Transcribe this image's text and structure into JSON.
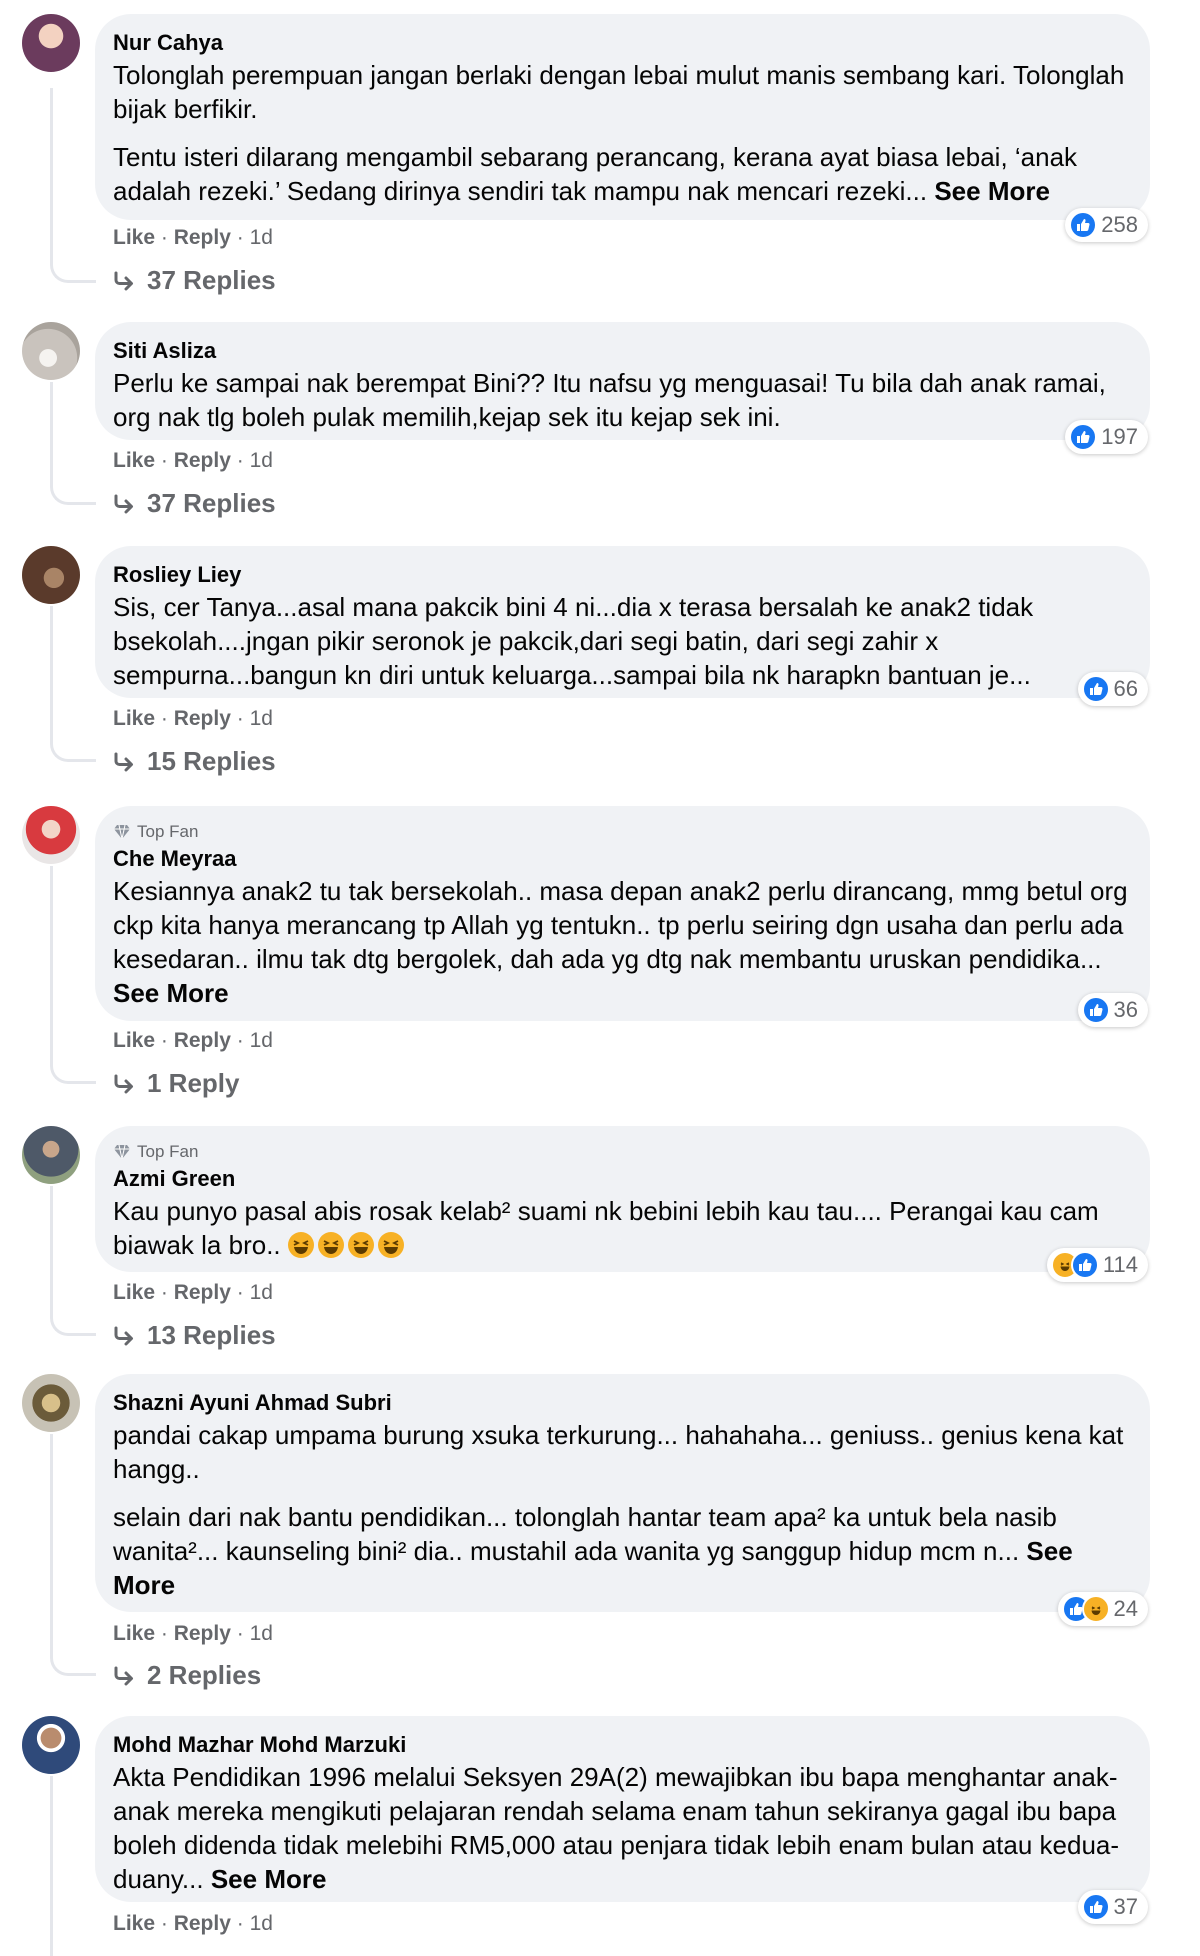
{
  "comments": [
    {
      "author": "Nur Cahya",
      "badge": "",
      "paragraphs": [
        "Tolonglah perempuan jangan berlaki dengan lebai mulut manis sembang kari. Tolonglah bijak berfikir.",
        "Tentu isteri dilarang mengambil sebarang perancang, kerana ayat biasa lebai, ‘anak adalah rezeki.’ Sedang dirinya sendiri tak mampu nak mencari rezeki..."
      ],
      "see_more": "See More",
      "reaction_count": "258",
      "reactions": [
        "like-icon"
      ],
      "like": "Like",
      "reply": "Reply",
      "time": "1d",
      "replies": "37 Replies",
      "avatar_color": "#7a4a6a"
    },
    {
      "author": "Siti Asliza",
      "badge": "",
      "paragraphs": [
        "Perlu ke sampai nak berempat Bini?? Itu nafsu yg menguasai! Tu bila dah anak ramai, org nak tlg boleh pulak memilih,kejap sek itu kejap sek ini."
      ],
      "see_more": "",
      "reaction_count": "197",
      "reactions": [
        "like-icon"
      ],
      "like": "Like",
      "reply": "Reply",
      "time": "1d",
      "replies": "37 Replies",
      "avatar_color": "#c9c3bd"
    },
    {
      "author": "Rosliey Liey",
      "badge": "",
      "paragraphs": [
        "Sis, cer Tanya...asal mana pakcik bini 4 ni...dia x terasa bersalah ke anak2 tidak bsekolah....jngan pikir seronok je pakcik,dari segi batin, dari segi zahir x sempurna...bangun kn diri untuk keluarga...sampai bila nk harapkn bantuan je..."
      ],
      "see_more": "",
      "reaction_count": "66",
      "reactions": [
        "like-icon"
      ],
      "like": "Like",
      "reply": "Reply",
      "time": "1d",
      "replies": "15 Replies",
      "avatar_color": "#6b4b3b"
    },
    {
      "author": "Che Meyraa",
      "badge": "Top Fan",
      "paragraphs": [
        "Kesiannya anak2 tu tak bersekolah.. masa depan anak2 perlu dirancang, mmg betul org ckp kita hanya merancang tp Allah yg tentukn.. tp perlu seiring dgn usaha dan perlu ada kesedaran.. ilmu tak dtg bergolek, dah ada yg dtg nak membantu uruskan pendidika..."
      ],
      "see_more": "See More",
      "reaction_count": "36",
      "reactions": [
        "like-icon"
      ],
      "like": "Like",
      "reply": "Reply",
      "time": "1d",
      "replies": "1 Reply",
      "avatar_color": "#b5303a"
    },
    {
      "author": "Azmi Green",
      "badge": "Top Fan",
      "paragraphs": [
        "Kau punyo pasal abis rosak kelab² suami nk bebini lebih kau tau.... Perangai kau cam biawak la bro.."
      ],
      "emoji_count": 4,
      "see_more": "",
      "reaction_count": "114",
      "reactions": [
        "haha-icon",
        "like-icon"
      ],
      "like": "Like",
      "reply": "Reply",
      "time": "1d",
      "replies": "13 Replies",
      "avatar_color": "#556070"
    },
    {
      "author": "Shazni Ayuni Ahmad Subri",
      "badge": "",
      "paragraphs": [
        "pandai cakap umpama burung xsuka terkurung... hahahaha... geniuss.. genius kena kat hangg..",
        "selain dari nak bantu pendidikan... tolonglah hantar team apa² ka untuk bela nasib wanita²... kaunseling bini² dia.. mustahil ada wanita yg sanggup hidup mcm n..."
      ],
      "see_more": "See More",
      "reaction_count": "24",
      "reactions": [
        "like-icon",
        "haha-icon"
      ],
      "like": "Like",
      "reply": "Reply",
      "time": "1d",
      "replies": "2 Replies",
      "avatar_color": "#8a7a55"
    },
    {
      "author": "Mohd Mazhar Mohd Marzuki",
      "badge": "",
      "paragraphs": [
        "Akta Pendidikan 1996 melalui Seksyen 29A(2) mewajibkan ibu bapa menghantar anak-anak mereka mengikuti pelajaran rendah selama enam tahun sekiranya gagal ibu bapa boleh didenda tidak melebihi RM5,000 atau penjara tidak lebih enam bulan atau kedua- duany..."
      ],
      "see_more": "See More",
      "reaction_count": "37",
      "reactions": [
        "like-icon"
      ],
      "like": "Like",
      "reply": "Reply",
      "time": "1d",
      "replies": "",
      "avatar_color": "#2f4a7a"
    }
  ]
}
